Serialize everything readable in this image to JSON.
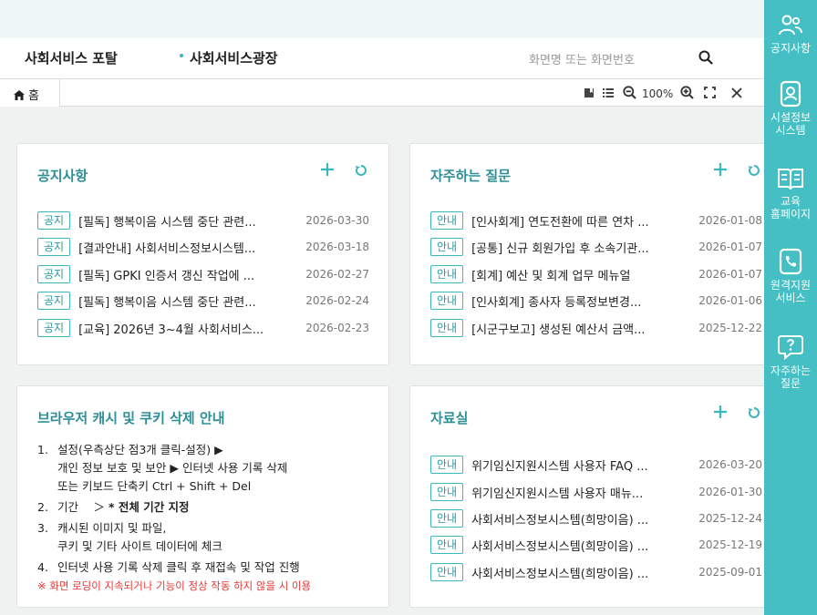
{
  "header": {
    "portal_title": "사회서비스 포탈",
    "square_title": "사회서비스광장",
    "search_placeholder": "화면명 또는 화면번호"
  },
  "tabs": [
    {
      "label": "홈"
    }
  ],
  "toolbar": {
    "zoom": "100%"
  },
  "notices": {
    "title": "공지사항",
    "items": [
      {
        "badge": "공지",
        "text": "[필독] 행복이음 시스템 중단 관련...",
        "date": "2026-03-30"
      },
      {
        "badge": "공지",
        "text": "[결과안내] 사회서비스정보시스템...",
        "date": "2026-03-18"
      },
      {
        "badge": "공지",
        "text": "[필독] GPKI 인증서 갱신 작업에 ...",
        "date": "2026-02-27"
      },
      {
        "badge": "공지",
        "text": "[필독] 행복이음 시스템 중단 관련...",
        "date": "2026-02-24"
      },
      {
        "badge": "공지",
        "text": "[교육] 2026년 3~4월 사회서비스...",
        "date": "2026-02-23"
      }
    ]
  },
  "faq": {
    "title": "자주하는 질문",
    "items": [
      {
        "badge": "안내",
        "text": "[인사회계] 연도전환에 따른 연차 ...",
        "date": "2026-01-08"
      },
      {
        "badge": "안내",
        "text": "[공통] 신규 회원가입 후 소속기관...",
        "date": "2026-01-07"
      },
      {
        "badge": "안내",
        "text": "[회계] 예산 및 회계 업무 메뉴얼",
        "date": "2026-01-07"
      },
      {
        "badge": "안내",
        "text": "[인사회계] 종사자 등록정보변경...",
        "date": "2026-01-06"
      },
      {
        "badge": "안내",
        "text": "[시군구보고] 생성된 예산서 금액...",
        "date": "2025-12-22"
      }
    ]
  },
  "guide": {
    "title": "브라우저 캐시 및 쿠키 삭제 안내",
    "steps": [
      {
        "num": "1.",
        "line1": "설정(우측상단 점3개 클릭-설정) ▶",
        "line2": "개인 정보 보호 및 보안 ▶ 인터넷 사용 기록 삭제",
        "line3": "또는 키보드 단축키 Ctrl + Shift + Del"
      },
      {
        "num": "2.",
        "line1": "기간　 ＞ ",
        "bold": "* 전체 기간 지정"
      },
      {
        "num": "3.",
        "line1": "캐시된 이미지 및 파일,",
        "line2": "쿠키 및 기타 사이트 데이터에 체크"
      },
      {
        "num": "4.",
        "line1": "인터넷 사용 기록 삭제 클릭 후 재접속 및 작업 진행"
      }
    ],
    "note": "※ 화면 로딩이 지속되거나 기능이 정상 작동 하지 않을 시 이용"
  },
  "library": {
    "title": "자료실",
    "items": [
      {
        "badge": "안내",
        "text": "위기임신지원시스템 사용자 FAQ ...",
        "date": "2026-03-20"
      },
      {
        "badge": "안내",
        "text": "위기임신지원시스템 사용자 매뉴...",
        "date": "2026-01-30"
      },
      {
        "badge": "안내",
        "text": "사회서비스정보시스템(희망이음) ...",
        "date": "2025-12-24"
      },
      {
        "badge": "안내",
        "text": "사회서비스정보시스템(희망이음) ...",
        "date": "2025-12-19"
      },
      {
        "badge": "안내",
        "text": "사회서비스정보시스템(희망이음) ...",
        "date": "2025-09-01"
      }
    ]
  },
  "rightbar": {
    "items": [
      {
        "label": "공지사항",
        "icon": "people-icon"
      },
      {
        "label": "시설정보\n시스템",
        "icon": "id-card-icon"
      },
      {
        "label": "교육\n홈페이지",
        "icon": "book-icon"
      },
      {
        "label": "원격지원\n서비스",
        "icon": "phone-icon"
      },
      {
        "label": "자주하는\n질문",
        "icon": "question-chat-icon"
      }
    ]
  },
  "colors": {
    "accent": "#45bfc3",
    "title": "#2d8f96",
    "note": "#e53935"
  }
}
